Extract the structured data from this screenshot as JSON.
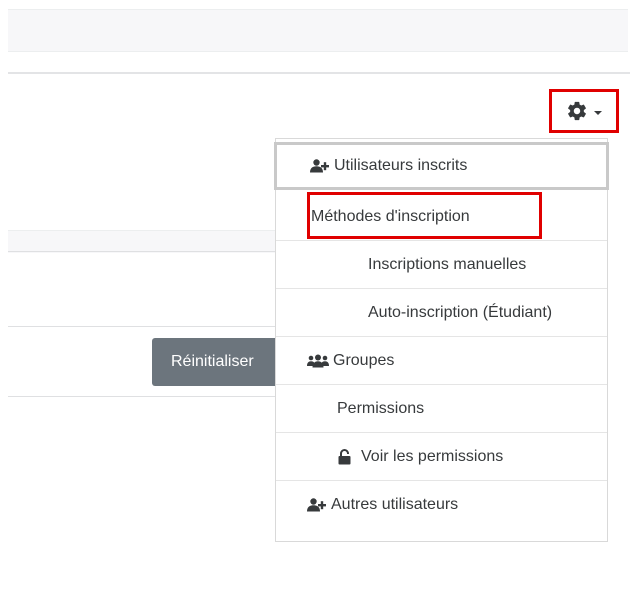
{
  "reset_button": {
    "label": "Réinitialiser"
  },
  "menu": {
    "items": [
      {
        "label": "Utilisateurs inscrits",
        "icon": "user-plus-icon"
      },
      {
        "label": "Méthodes d'inscription",
        "icon": ""
      },
      {
        "label": "Inscriptions manuelles",
        "icon": ""
      },
      {
        "label": "Auto-inscription (Étudiant)",
        "icon": ""
      },
      {
        "label": "Groupes",
        "icon": "users-icon"
      },
      {
        "label": "Permissions",
        "icon": ""
      },
      {
        "label": "Voir les permissions",
        "icon": "unlock-icon"
      },
      {
        "label": "Autres utilisateurs",
        "icon": "user-plus-icon"
      }
    ]
  },
  "colors": {
    "highlight": "#e00000",
    "button": "#6c757d",
    "text": "#373a3c"
  }
}
